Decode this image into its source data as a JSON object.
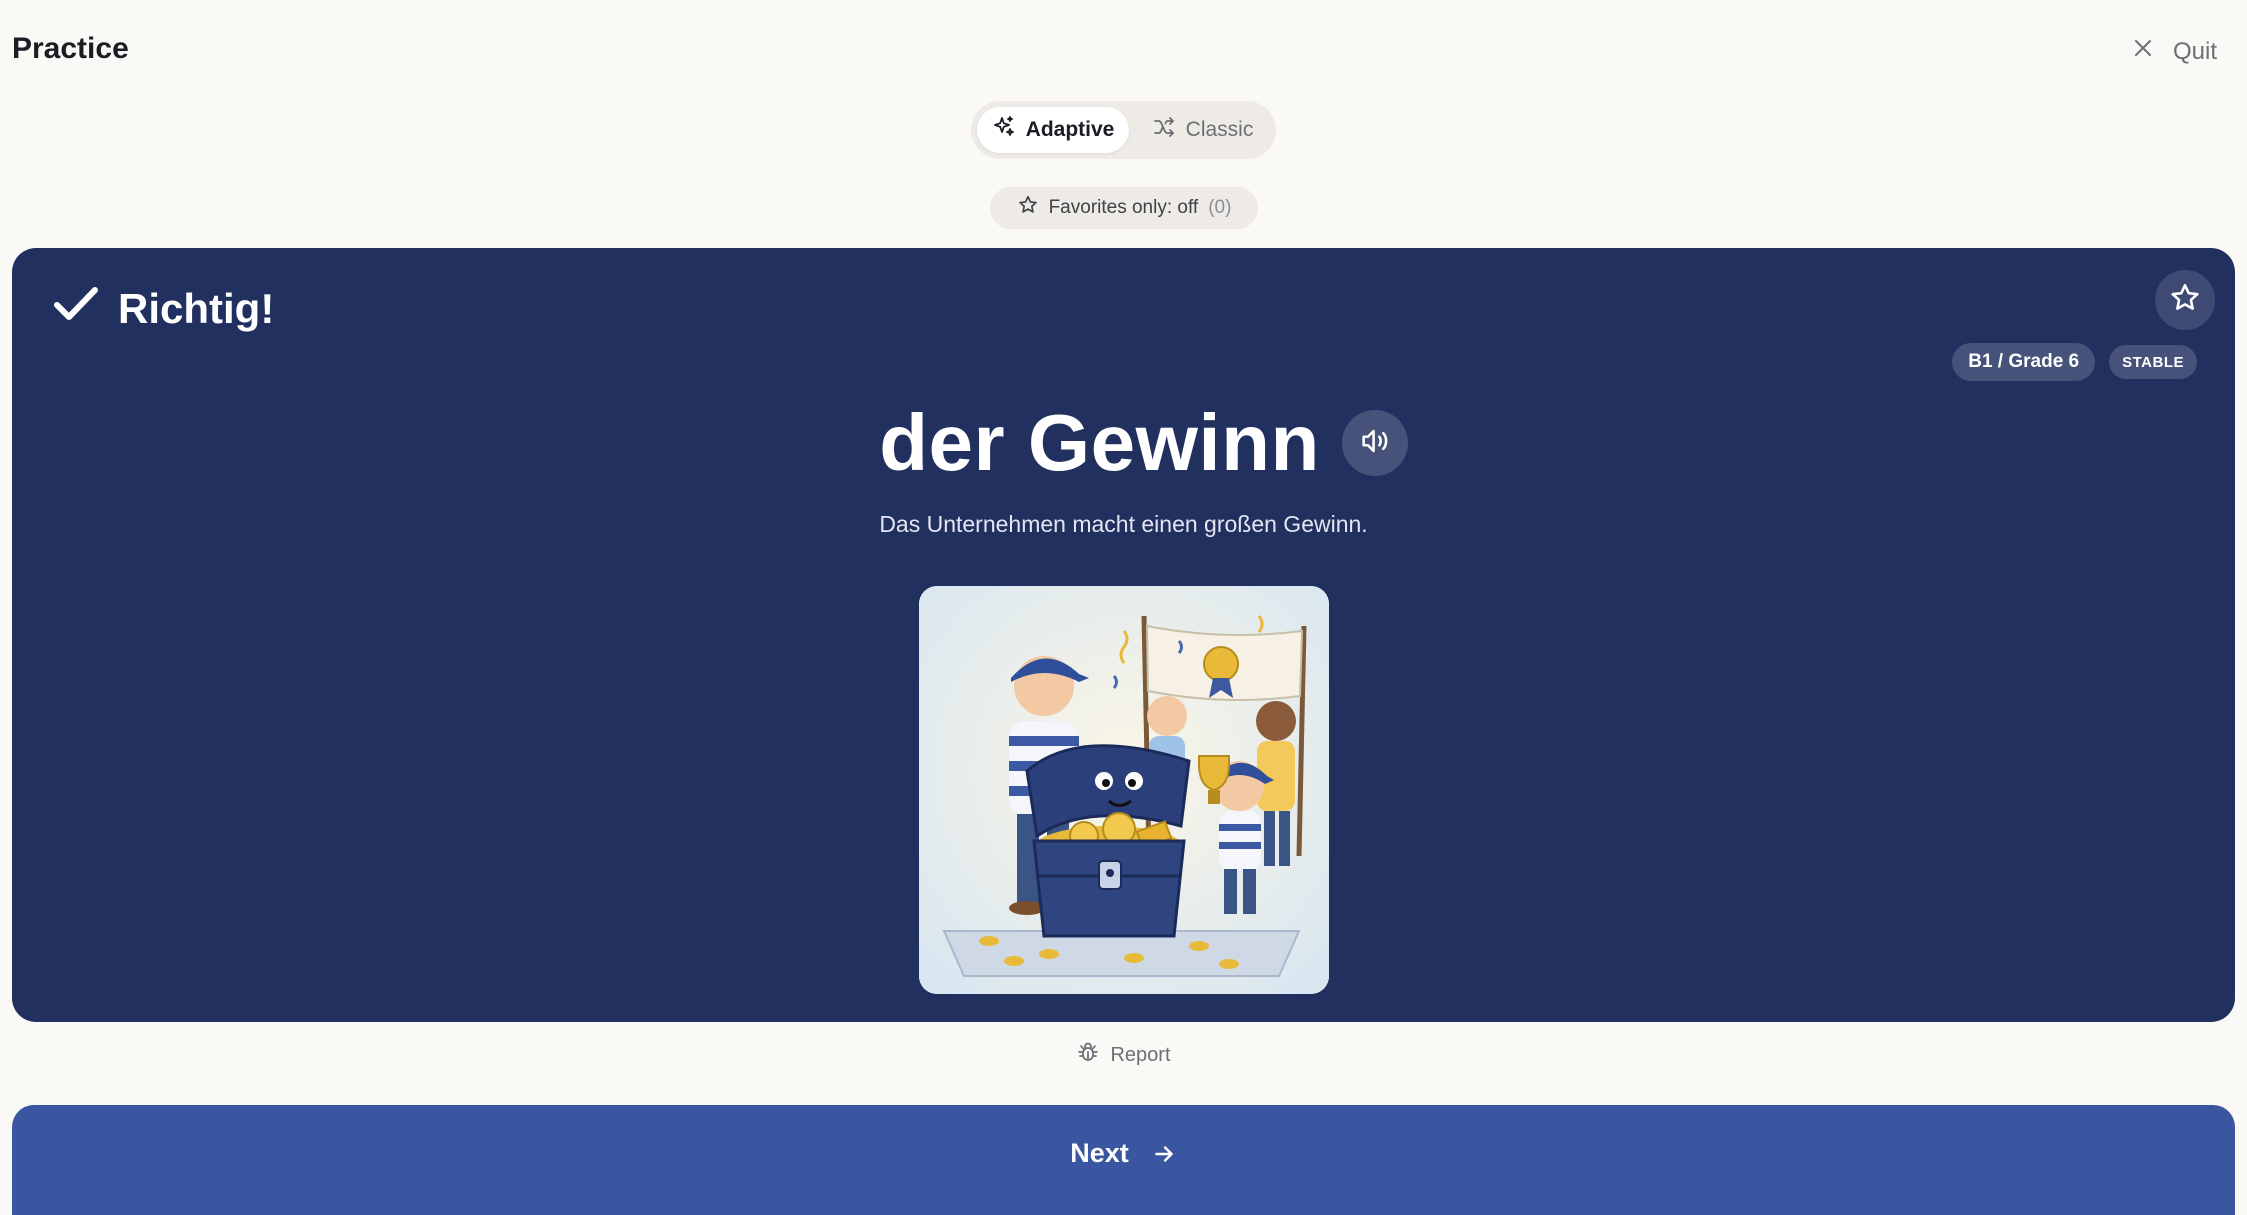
{
  "header": {
    "title": "Practice",
    "quit_label": "Quit"
  },
  "mode_toggle": {
    "options": [
      {
        "label": "Adaptive",
        "icon": "sparkles-icon",
        "active": true
      },
      {
        "label": "Classic",
        "icon": "shuffle-icon",
        "active": false
      }
    ]
  },
  "favorites_filter": {
    "label": "Favorites only: off",
    "count": "(0)",
    "icon": "star-outline-icon"
  },
  "card": {
    "result_text": "Richtig!",
    "level_badge": "B1 / Grade 6",
    "status_badge": "STABLE",
    "word": "der Gewinn",
    "example_sentence": "Das Unternehmen macht einen großen Gewinn.",
    "background_color": "#223060",
    "accent_color": "#3b56a0"
  },
  "report_label": "Report",
  "next_label": "Next"
}
